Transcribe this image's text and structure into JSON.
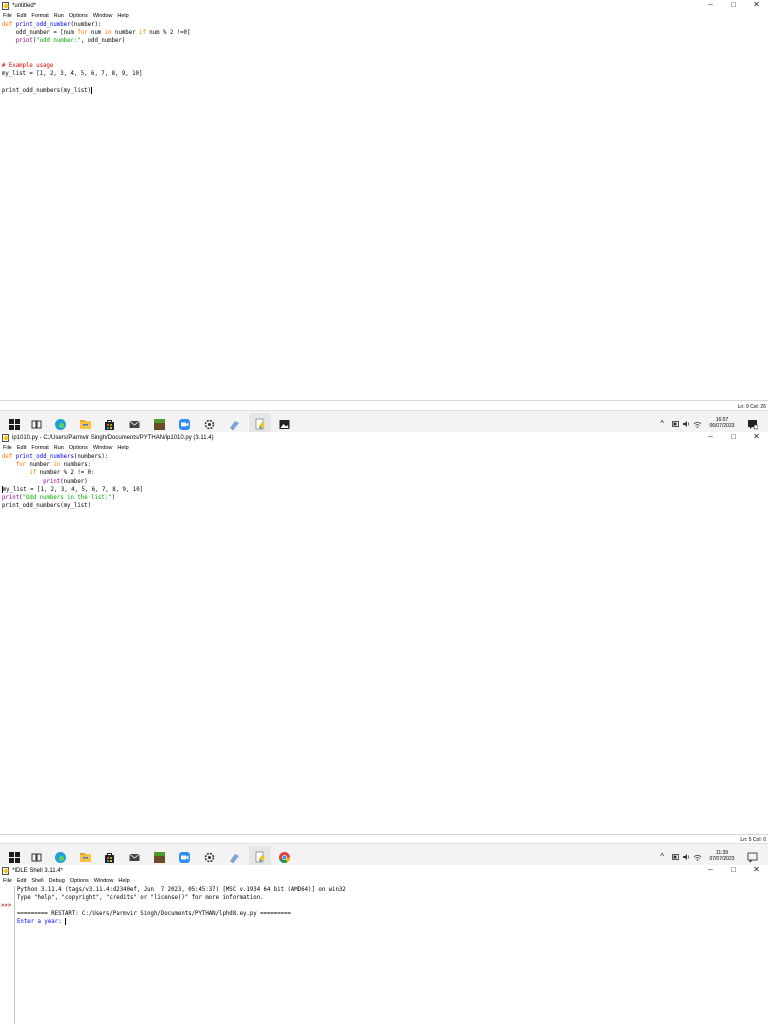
{
  "win1": {
    "title": "*untitled*",
    "menu": [
      "File",
      "Edit",
      "Format",
      "Run",
      "Options",
      "Window",
      "Help"
    ],
    "code": [
      [
        {
          "t": "def ",
          "c": "kw"
        },
        {
          "t": "print_odd_number",
          "c": "def"
        },
        {
          "t": "(number):",
          "c": ""
        }
      ],
      [
        {
          "t": "    odd_number = [num ",
          "c": ""
        },
        {
          "t": "for",
          "c": "kw"
        },
        {
          "t": " num ",
          "c": ""
        },
        {
          "t": "in",
          "c": "kw"
        },
        {
          "t": " number ",
          "c": ""
        },
        {
          "t": "if",
          "c": "kw"
        },
        {
          "t": " num % 2 !=0]",
          "c": ""
        }
      ],
      [
        {
          "t": "    ",
          "c": ""
        },
        {
          "t": "print",
          "c": "bi"
        },
        {
          "t": "(",
          "c": ""
        },
        {
          "t": "\"odd number:\"",
          "c": "str"
        },
        {
          "t": ", odd_number)",
          "c": ""
        }
      ],
      [],
      [],
      [
        {
          "t": "# Example usage",
          "c": "cmt"
        }
      ],
      [
        {
          "t": "my_list = [1, 2, 3, 4, 5, 6, 7, 8, 9, 10]",
          "c": ""
        }
      ],
      [],
      [
        {
          "t": "print_odd_numbers(my_list)",
          "c": ""
        }
      ]
    ],
    "status": "Ln: 9   Col: 26"
  },
  "taskbar1": {
    "time": "16:07",
    "date": "06/07/2023"
  },
  "win2": {
    "title": "ip1010.py - C:/Users/Parmvir Singh/Documents/PYTHAN/ip1010.py (3.11.4)",
    "menu": [
      "File",
      "Edit",
      "Format",
      "Run",
      "Options",
      "Window",
      "Help"
    ],
    "code": [
      [
        {
          "t": "def ",
          "c": "kw"
        },
        {
          "t": "print_odd_numbers",
          "c": "def"
        },
        {
          "t": "(numbers):",
          "c": ""
        }
      ],
      [
        {
          "t": "    ",
          "c": ""
        },
        {
          "t": "for",
          "c": "kw"
        },
        {
          "t": " number ",
          "c": ""
        },
        {
          "t": "in",
          "c": "kw"
        },
        {
          "t": " numbers:",
          "c": ""
        }
      ],
      [
        {
          "t": "        ",
          "c": ""
        },
        {
          "t": "if",
          "c": "kw"
        },
        {
          "t": " number % 2 != 0:",
          "c": ""
        }
      ],
      [
        {
          "t": "            ",
          "c": ""
        },
        {
          "t": "print",
          "c": "bi"
        },
        {
          "t": "(number)",
          "c": ""
        }
      ],
      [
        {
          "t": "my_list = [1, 2, 3, 4, 5, 6, 7, 8, 9, 10]",
          "c": ""
        }
      ],
      [
        {
          "t": "print",
          "c": "bi"
        },
        {
          "t": "(",
          "c": ""
        },
        {
          "t": "\"Odd numbers in the list:\"",
          "c": "str"
        },
        {
          "t": ")",
          "c": ""
        }
      ],
      [
        {
          "t": "print_odd_numbers(my_list)",
          "c": ""
        }
      ]
    ],
    "status": "Ln: 5   Col: 0"
  },
  "taskbar2": {
    "time": "11:39",
    "date": "07/07/2023"
  },
  "win3": {
    "title": "*IDLE Shell 3.11.4*",
    "menu": [
      "File",
      "Edit",
      "Shell",
      "Debug",
      "Options",
      "Window",
      "Help"
    ],
    "prompt": ">>>",
    "lines": [
      {
        "t": "Python 3.11.4 (tags/v3.11.4:d2340ef, Jun  7 2023, 05:45:37) [MSC v.1934 64 bit (AMD64)] on win32",
        "c": ""
      },
      {
        "t": "Type \"help\", \"copyright\", \"credits\" or \"license()\" for more information.",
        "c": ""
      },
      {
        "t": "",
        "c": ""
      },
      {
        "t": "========= RESTART: C:/Users/Parmvir Singh/Documents/PYTHAN/lphd8.ey.py =========",
        "c": ""
      },
      {
        "t": "Enter a year: ",
        "c": "blue"
      }
    ]
  },
  "controls": {
    "minimize": "–",
    "maximize": "□",
    "close": "✕"
  },
  "colors": {
    "keyword": "#ff7700",
    "defname": "#0000ff",
    "string": "#00aa00",
    "comment": "#dd0000",
    "builtin": "#900090"
  }
}
